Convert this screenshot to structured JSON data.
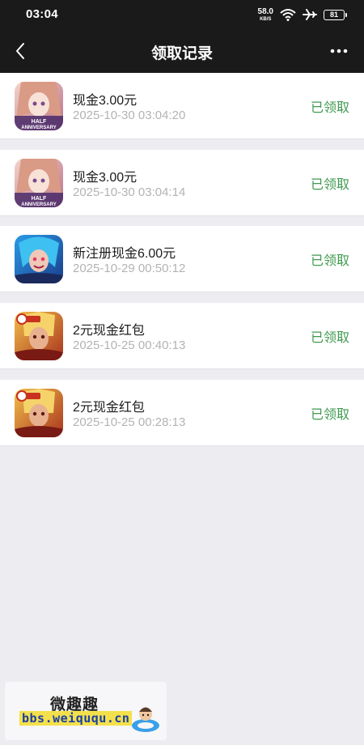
{
  "status_bar": {
    "time": "03:04",
    "network_speed": "58.0",
    "network_unit": "KB/S",
    "battery": "81"
  },
  "nav": {
    "title": "领取记录",
    "back_icon": "chevron-left-icon",
    "more_icon": "more-dots-icon"
  },
  "records": [
    {
      "title": "现金3.00元",
      "time": "2025-10-30 03:04:20",
      "status": "已领取",
      "icon": "anime-girl-anniversary-icon"
    },
    {
      "title": "现金3.00元",
      "time": "2025-10-30 03:04:14",
      "status": "已领取",
      "icon": "anime-girl-anniversary-icon"
    },
    {
      "title": "新注册现金6.00元",
      "time": "2025-10-29 00:50:12",
      "status": "已领取",
      "icon": "blue-hair-hero-icon"
    },
    {
      "title": "2元现金红包",
      "time": "2025-10-25 00:40:13",
      "status": "已领取",
      "icon": "golden-warrior-icon"
    },
    {
      "title": "2元现金红包",
      "time": "2025-10-25 00:28:13",
      "status": "已领取",
      "icon": "golden-warrior-icon"
    }
  ],
  "watermark": {
    "text": "微趣趣",
    "url": "bbs.weiququ.cn"
  },
  "colors": {
    "status_green": "#3f9a50",
    "header_bg": "#1a1a1a",
    "page_bg": "#ededf1"
  }
}
